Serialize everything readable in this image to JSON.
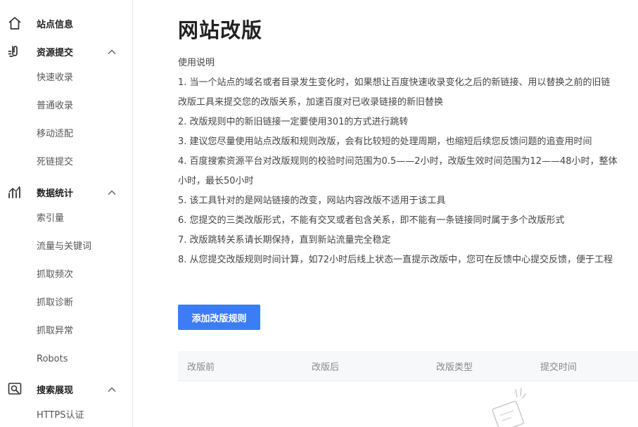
{
  "sidebar": {
    "site_info_label": "站点信息",
    "groups": [
      {
        "label": "资源提交",
        "items": [
          "快速收录",
          "普通收录",
          "移动适配",
          "死链提交"
        ]
      },
      {
        "label": "数据统计",
        "items": [
          "索引量",
          "流量与关键词",
          "抓取频次",
          "抓取诊断",
          "抓取异常",
          "Robots"
        ]
      },
      {
        "label": "搜索展现",
        "items": [
          "HTTPS认证"
        ]
      }
    ]
  },
  "main": {
    "title": "网站改版",
    "instructions": [
      "使用说明",
      "1. 当一个站点的域名或者目录发生变化时，如果想让百度快速收录变化之后的新链接、用以替换之前的旧链",
      "改版工具来提交您的改版关系，加速百度对已收录链接的新旧替换",
      "2. 改版规则中的新旧链接一定要使用301的方式进行跳转",
      "3. 建议您尽量使用站点改版和规则改版，会有比较短的处理周期，也缩短后续您反馈问题的追查用时间",
      "4. 百度搜索资源平台对改版规则的校验时间范围为0.5——2小时，改版生效时间范围为12——48小时，整体",
      "小时，最长50小时",
      "5. 该工具针对的是网站链接的改变，网站内容改版不适用于该工具",
      "6. 您提交的三类改版形式，不能有交叉或者包含关系，即不能有一条链接同时属于多个改版形式",
      "7. 改版跳转关系请长期保持，直到新站流量完全稳定",
      "8. 从您提交改版规则时间计算，如72小时后线上状态一直提示改版中，您可在反馈中心提交反馈，便于工程"
    ],
    "add_button_label": "添加改版规则",
    "table_columns": [
      "改版前",
      "改版后",
      "改版类型",
      "提交时间"
    ]
  },
  "colors": {
    "accent": "#3b7df4",
    "sidebar_border": "#ececec",
    "table_header_bg": "#f7f8fa"
  },
  "icons": {
    "site_info": "home-icon",
    "resource_submit": "submit-icon",
    "data_stats": "stats-chart-icon",
    "search_display": "search-display-icon",
    "group_toggle": "chevron-up-icon",
    "empty_state": "empty-state-illustration"
  }
}
